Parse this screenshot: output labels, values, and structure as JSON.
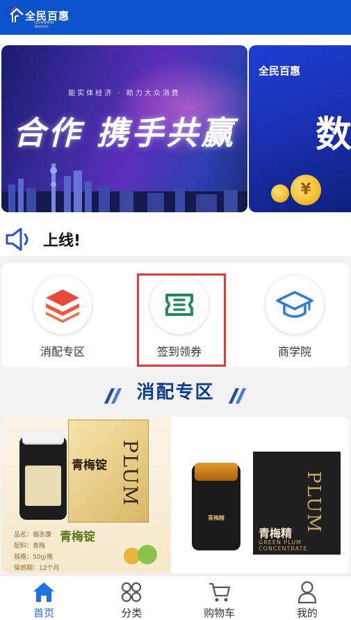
{
  "header": {
    "app_name": "全民百惠",
    "app_name_en": "QUANMIN BAIHUI"
  },
  "banner": {
    "subtitle": "能实体经济 · 助力大众消费",
    "headline": "合作 携手共赢",
    "next_headline": "数",
    "coin_symbol": "¥",
    "dot_count": 6,
    "active_dot": 6
  },
  "notice": {
    "text": "上线!"
  },
  "menu": {
    "items": [
      {
        "label": "消配专区",
        "icon": "layers-icon"
      },
      {
        "label": "签到领券",
        "icon": "coupon-icon"
      },
      {
        "label": "商学院",
        "icon": "graduation-cap-icon"
      }
    ]
  },
  "section": {
    "title": "消配专区"
  },
  "product": {
    "left_box_cn": "青梅锭",
    "left_box_en": "PLUM",
    "left_name": "青梅锭",
    "left_info": [
      "品名：福赤康",
      "配料：青梅",
      "规格：50g/瓶",
      "保质期：12个月"
    ],
    "right_box_cn": "青梅精",
    "right_box_en": "PLUM",
    "right_box_en2": "GREEN PLUM CONCENTRATE",
    "right_jar_label": "青梅精"
  },
  "tabbar": {
    "items": [
      {
        "label": "首页",
        "icon": "home-icon",
        "active": true
      },
      {
        "label": "分类",
        "icon": "category-icon",
        "active": false
      },
      {
        "label": "购物车",
        "icon": "cart-icon",
        "active": false
      },
      {
        "label": "我的",
        "icon": "user-icon",
        "active": false
      }
    ]
  },
  "colors": {
    "brand_blue": "#0c52cc",
    "section_title": "#0d3b8e",
    "tab_active": "#1f6fe5",
    "highlight_border": "#e23a3a"
  }
}
